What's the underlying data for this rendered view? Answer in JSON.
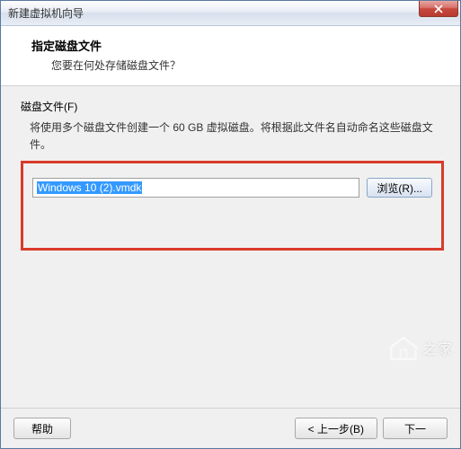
{
  "window": {
    "title": "新建虚拟机向导"
  },
  "header": {
    "title": "指定磁盘文件",
    "subtitle": "您要在何处存储磁盘文件？"
  },
  "content": {
    "field_label": "磁盘文件(F)",
    "field_desc": "将使用多个磁盘文件创建一个 60 GB 虚拟磁盘。将根据此文件名自动命名这些磁盘文件。",
    "file_value": "Windows 10 (2).vmdk",
    "browse_label": "浏览(R)..."
  },
  "footer": {
    "help_label": "帮助",
    "back_label": "< 上一步(B)",
    "next_label": "下一",
    "cancel_label": ""
  },
  "watermark": {
    "text": "之家"
  }
}
